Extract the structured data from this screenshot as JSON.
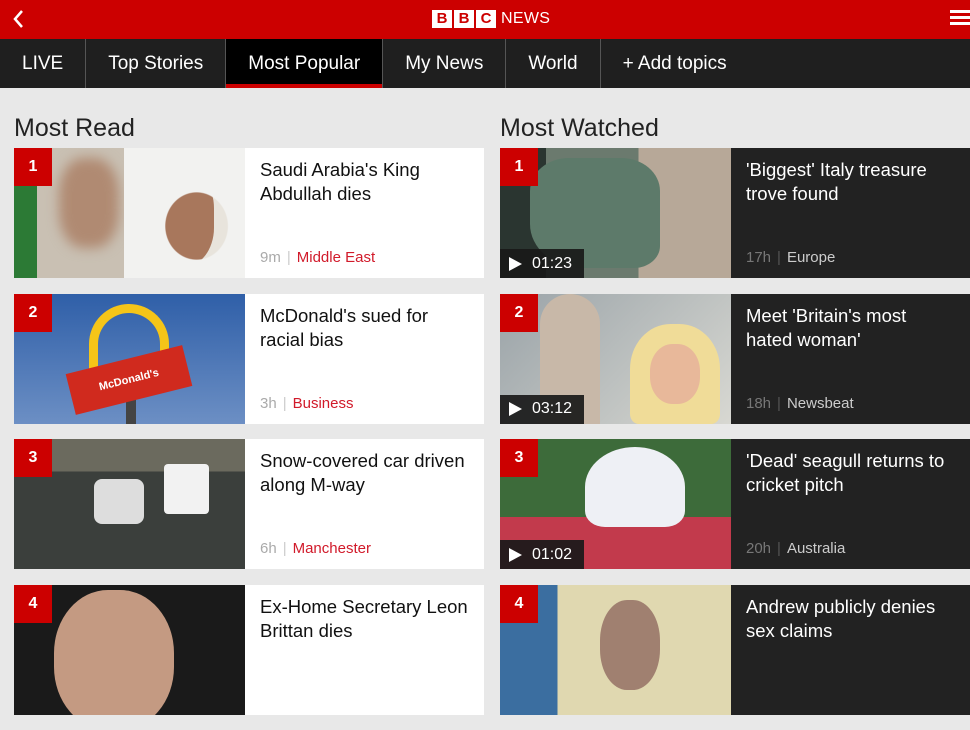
{
  "header": {
    "logo_letters": [
      "B",
      "B",
      "C"
    ],
    "logo_text": "NEWS",
    "back_icon": "chevron-left-icon",
    "menu_icon": "hamburger-menu-icon"
  },
  "nav": {
    "tabs": [
      {
        "label": "LIVE",
        "active": false
      },
      {
        "label": "Top Stories",
        "active": false
      },
      {
        "label": "Most Popular",
        "active": true
      },
      {
        "label": "My News",
        "active": false
      },
      {
        "label": "World",
        "active": false
      },
      {
        "label": "+ Add topics",
        "active": false
      }
    ]
  },
  "most_read": {
    "heading": "Most Read",
    "items": [
      {
        "rank": "1",
        "title": "Saudi Arabia's King Abdullah dies",
        "time": "9m",
        "section": "Middle East"
      },
      {
        "rank": "2",
        "title": "McDonald's sued for racial bias",
        "time": "3h",
        "section": "Business"
      },
      {
        "rank": "3",
        "title": "Snow-covered car driven along M-way",
        "time": "6h",
        "section": "Manchester"
      },
      {
        "rank": "4",
        "title": "Ex-Home Secretary Leon Brittan dies",
        "time": "",
        "section": ""
      }
    ]
  },
  "most_watched": {
    "heading": "Most Watched",
    "items": [
      {
        "rank": "1",
        "title": "'Biggest' Italy treasure trove found",
        "duration": "01:23",
        "time": "17h",
        "section": "Europe"
      },
      {
        "rank": "2",
        "title": "Meet 'Britain's most hated woman'",
        "duration": "03:12",
        "time": "18h",
        "section": "Newsbeat"
      },
      {
        "rank": "3",
        "title": "'Dead' seagull returns to cricket pitch",
        "duration": "01:02",
        "time": "20h",
        "section": "Australia"
      },
      {
        "rank": "4",
        "title": "Andrew publicly denies sex claims",
        "duration": "",
        "time": "",
        "section": ""
      }
    ]
  },
  "colors": {
    "brand_red": "#cc0000",
    "nav_bg": "#1f1f1f",
    "page_bg": "#e8e8e8",
    "section_red": "#d11a2a"
  },
  "meta_separator": "|"
}
